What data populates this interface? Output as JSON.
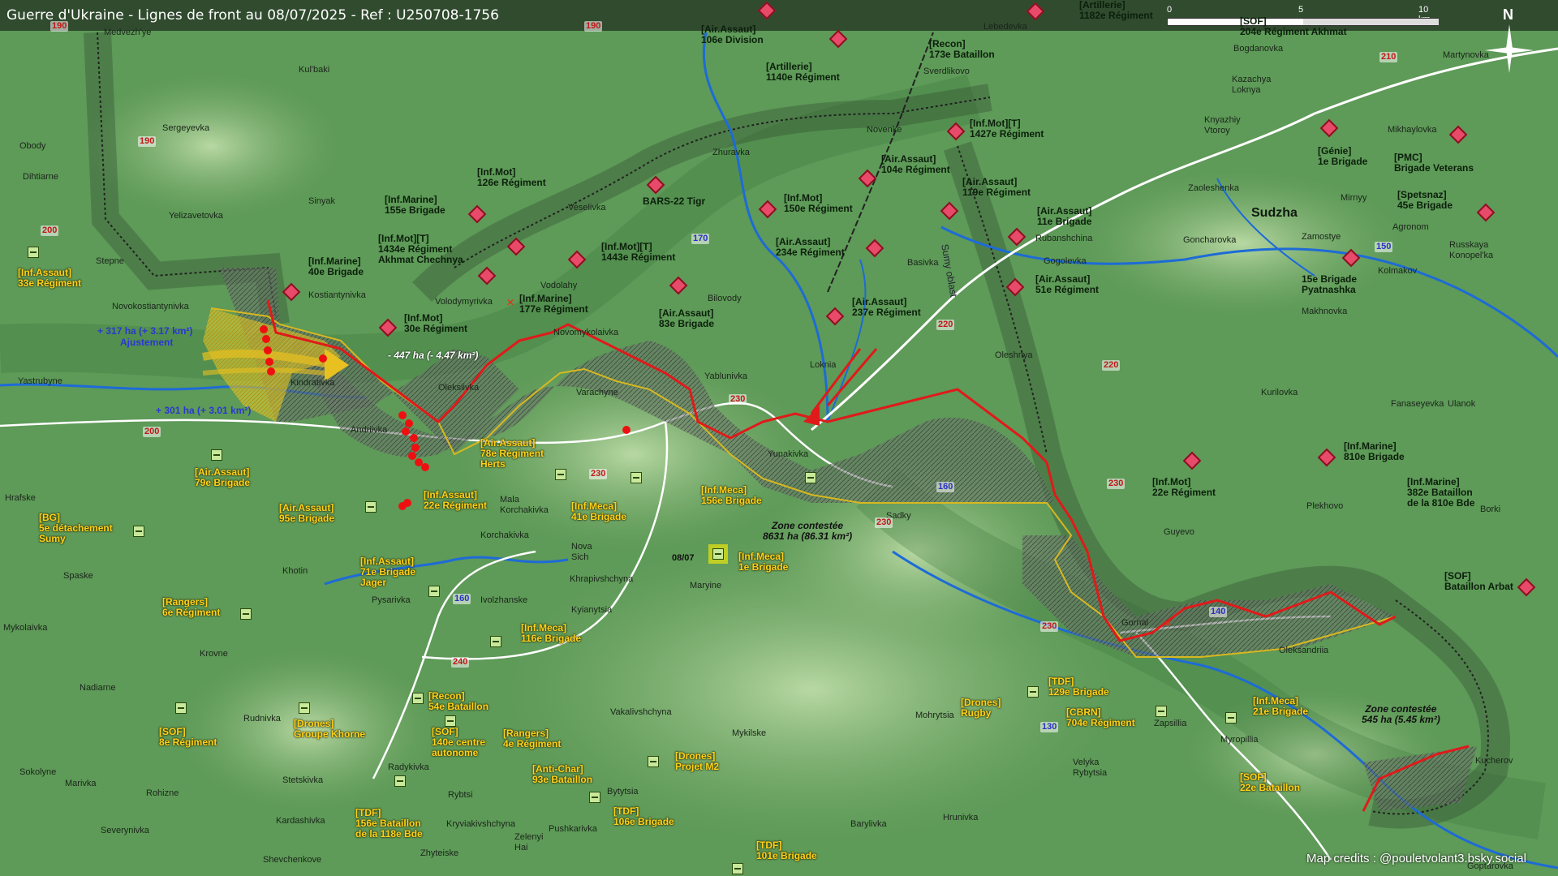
{
  "title": "Guerre d'Ukraine - Lignes de front au 08/07/2025 - Ref : U250708-1756",
  "scale_bar": {
    "labels": [
      "0",
      "5",
      "10 km"
    ]
  },
  "north_label": "N",
  "credits": "Map credits : @pouletvolant3.bsky.social",
  "colors": {
    "russian_unit": "#e84a6a",
    "ukrainian_unit": "#c8e89a",
    "front_line": "#e01a1a",
    "ua_line": "#d8b820",
    "contested_fill": "#6a7a6a",
    "water": "#1e6bd6",
    "road": "#ffffff"
  },
  "annotations": {
    "gain1": "+ 317 ha (+ 3.17 km²)",
    "gain1_sub": "Ajustement",
    "gain2": "+ 301 ha (+ 3.01 km²)",
    "loss": "- 447 ha (- 4.47 km²)",
    "zone1": "Zone contestée\n8631 ha (86.31 km²)",
    "zone2": "Zone contestée\n545 ha (5.45 km²)",
    "date_marker": "08/07"
  },
  "russian_units": [
    "[Artillerie]\n1182e Régiment",
    "[Air.Assaut]\n106e Division",
    "[Recon]\n173e Bataillon",
    "[Artillerie]\n1140e Régiment",
    "[Inf.Mot][T]\n1427e Régiment",
    "[Air.Assaut]\n104e Régiment",
    "[Air.Assaut]\n119e Régiment",
    "[Inf.Mot]\n126e Régiment",
    "[Inf.Marine]\n155e Brigade",
    "BARS-22 Tigr",
    "[Inf.Mot]\n150e Régiment",
    "[Inf.Mot][T]\n1434e Régiment\nAkhmat Chechnya",
    "[Inf.Mot][T]\n1443e Régiment",
    "[Air.Assaut]\n234e Régiment",
    "[Air.Assaut]\n11e Brigade",
    "[Inf.Marine]\n40e Brigade",
    "[Air.Assaut]\n51e Régiment",
    "[Inf.Marine]\n177e Régiment",
    "[Air.Assaut]\n83e Brigade",
    "[Air.Assaut]\n237e Régiment",
    "[Inf.Mot]\n30e Régiment",
    "[Génie]\n1e Brigade",
    "[PMC]\nBrigade Veterans",
    "[Spetsnaz]\n45e Brigade",
    "15e Brigade\nPyatnashka",
    "[Inf.Mot]\n22e Régiment",
    "[Inf.Marine]\n810e Brigade",
    "[Inf.Marine]\n382e Bataillon\nde la 810e Bde",
    "[SOF]\nBataillon Arbat",
    "[SOF]\n204e Régiment Akhmat"
  ],
  "ukrainian_units": [
    "[Inf.Assaut]\n33e Régiment",
    "[Air.Assaut]\n79e Brigade",
    "[Air.Assaut]\n78e Régiment\nHerts",
    "[BG]\n5e détachement\nSumy",
    "[Air.Assaut]\n95e Brigade",
    "[Inf.Assaut]\n22e Régiment",
    "[Inf.Meca]\n41e Brigade",
    "[Inf.Meca]\n156e Brigade",
    "[Inf.Meca]\n1e Brigade",
    "[Inf.Assaut]\n71e Brigade\nJager",
    "[Rangers]\n6e Régiment",
    "[Inf.Meca]\n116e Brigade",
    "[Recon]\n54e Bataillon",
    "[Drones]\nGroupe Khorne",
    "[SOF]\n8e Régiment",
    "[SOF]\n140e centre\nautonome",
    "[Rangers]\n4e Régiment",
    "[Anti-Char]\n93e Bataillon",
    "[Drones]\nProjet M2",
    "[TDF]\n156e Bataillon\nde la 118e Bde",
    "[TDF]\n106e Brigade",
    "[TDF]\n101e Brigade",
    "[Drones]\nRugby",
    "[TDF]\n129e Brigade",
    "[CBRN]\n704e Régiment",
    "[Inf.Meca]\n21e Brigade",
    "[SOF]\n22e Bataillon"
  ],
  "towns": [
    "Sudzha"
  ],
  "places": [
    "Medvezh'ye",
    "Lebedevka",
    "Bogdanovka",
    "Martynovka",
    "Kul'baki",
    "Sverdlikovo",
    "Obody",
    "Sergeyevka",
    "Kazachya\nLoknya",
    "Knyazhiy\nVtoroy",
    "Mikhaylovka",
    "Novenke",
    "Zhuravka",
    "Dihtiarne",
    "Sinyak",
    "Yelizavetovka",
    "Veselivka",
    "Zaoleshenka",
    "Mirnyy",
    "Rubanshchina",
    "Goncharovka",
    "Zamostye",
    "Agronom",
    "Russkaya\nKonopel'ka",
    "Stepne",
    "Gogolevka",
    "Basivka",
    "Kolmakov",
    "Novokostiantynivka",
    "Kostiantynivka",
    "Volodymyrivka",
    "Vodolahy",
    "Bilovody",
    "Makhnovka",
    "Novomykolaivka",
    "Oleshnya",
    "Yastrubyne",
    "Kindrativka",
    "Oleksiivka",
    "Yablunivka",
    "Loknia",
    "Varachyne",
    "Andriivka",
    "Kurilovka",
    "Fanaseyevka",
    "Ulanok",
    "Yunakivka",
    "Sadky",
    "Hrafske",
    "Mala\nKorchakivka",
    "Plekhovo",
    "Borki",
    "Korchakivka",
    "Guyevo",
    "Nova\nSich",
    "Khotin",
    "Khrapivshchyna",
    "Spaske",
    "Pysarivka",
    "Ivolzhanske",
    "Kyianytsia",
    "Maryine",
    "Gornal",
    "Oleksandriia",
    "Mykolaivka",
    "Krovne",
    "Nadiarne",
    "Rudnivka",
    "Vakalivshchyna",
    "Mohrytsia",
    "Zapsillia",
    "Myropillia",
    "Mykilske",
    "Velyka\nRybytsia",
    "Kucherov",
    "Sokolyne",
    "Marivka",
    "Radykivka",
    "Rohizne",
    "Stetskivka",
    "Rybtsi",
    "Bytytsia",
    "Kardashivka",
    "Kryviakivshchyna",
    "Zelenyi\nHai",
    "Pushkarivka",
    "Barylivka",
    "Hrunivka",
    "Severynivka",
    "Shevchenkove",
    "Zhyteiske",
    "Goptarovka",
    "Sumy oblast"
  ],
  "road_numbers": [
    "190",
    "190",
    "190",
    "210",
    "200",
    "170",
    "150",
    "220",
    "220",
    "230",
    "230",
    "230",
    "230",
    "230",
    "200",
    "160",
    "160",
    "160",
    "140",
    "130",
    "240"
  ]
}
